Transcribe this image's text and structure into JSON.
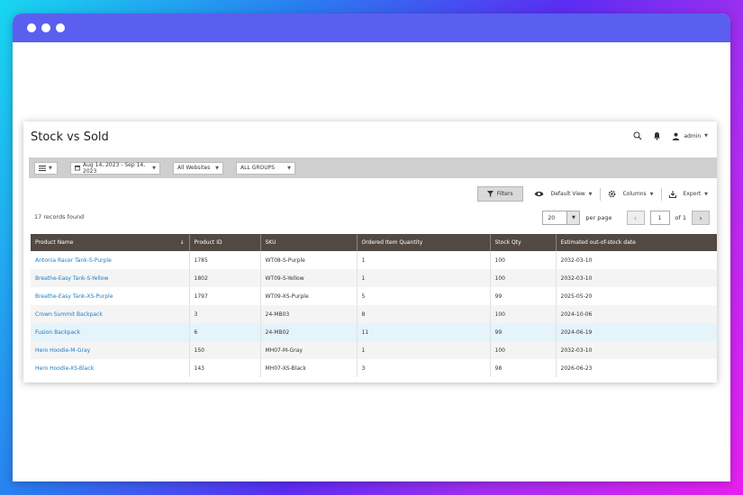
{
  "header": {
    "title": "Stock vs Sold",
    "user": "admin"
  },
  "toolbar": {
    "date_range": "Aug 14, 2023 - Sep 14, 2023",
    "website_select": "All Websites",
    "group_select": "ALL GROUPS"
  },
  "actions": {
    "filters": "Filters",
    "view": "Default View",
    "columns": "Columns",
    "export": "Export"
  },
  "grid": {
    "records": "17 records found",
    "per_page_value": "20",
    "per_page_label": "per page",
    "page": "1",
    "of_pages": "of 1",
    "columns": [
      "Product Name",
      "Product ID",
      "SKU",
      "Ordered Item Quantity",
      "Stock Qty",
      "Estimated out-of-stock date"
    ],
    "rows": [
      [
        "Antonia Racer Tank-S-Purple",
        "1785",
        "WT08-S-Purple",
        "1",
        "100",
        "2032-03-10"
      ],
      [
        "Breathe-Easy Tank-S-Yellow",
        "1802",
        "WT09-S-Yellow",
        "1",
        "100",
        "2032-03-10"
      ],
      [
        "Breathe-Easy Tank-XS-Purple",
        "1797",
        "WT09-XS-Purple",
        "5",
        "99",
        "2025-05-20"
      ],
      [
        "Crown Summit Backpack",
        "3",
        "24-MB03",
        "8",
        "100",
        "2024-10-06"
      ],
      [
        "Fusion Backpack",
        "6",
        "24-MB02",
        "11",
        "99",
        "2024-06-19"
      ],
      [
        "Hero Hoodie-M-Gray",
        "150",
        "MH07-M-Gray",
        "1",
        "100",
        "2032-03-10"
      ],
      [
        "Hero Hoodie-XS-Black",
        "143",
        "MH07-XS-Black",
        "3",
        "98",
        "2026-06-23"
      ]
    ]
  },
  "colors": {
    "header_bg": "#514943",
    "link": "#1a7dc4",
    "browser_bar": "#5a5ff0"
  }
}
